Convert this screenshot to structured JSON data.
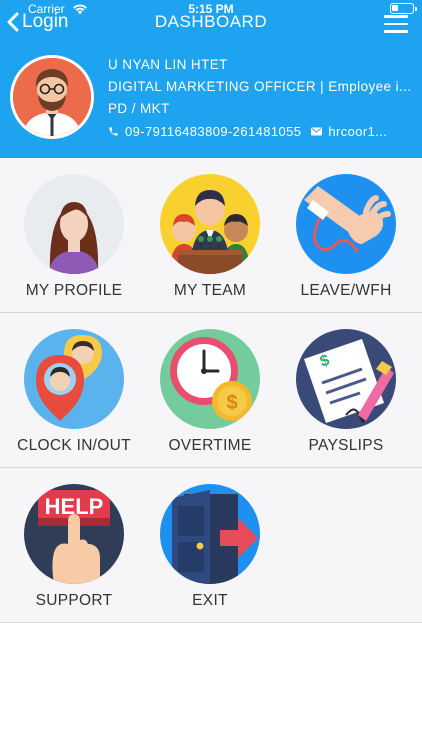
{
  "status_bar": {
    "carrier": "Carrier",
    "time": "5:15 PM"
  },
  "nav": {
    "back_label": "Login",
    "title": "DASHBOARD"
  },
  "profile": {
    "name": "U NYAN LIN HTET",
    "position": "DIGITAL MARKETING OFFICER | Employee i...",
    "department": "PD / MKT",
    "phone": "09-79116483809-261481055",
    "email": "hrcoor1..."
  },
  "tiles": [
    {
      "label": "MY PROFILE",
      "icon": "woman-profile-icon"
    },
    {
      "label": "MY TEAM",
      "icon": "team-icon"
    },
    {
      "label": "LEAVE/WFH",
      "icon": "bandaged-hand-icon"
    },
    {
      "label": "CLOCK IN/OUT",
      "icon": "location-pin-icon"
    },
    {
      "label": "OVERTIME",
      "icon": "clock-coin-icon"
    },
    {
      "label": "PAYSLIPS",
      "icon": "payslip-pen-icon"
    },
    {
      "label": "SUPPORT",
      "icon": "help-button-icon"
    },
    {
      "label": "EXIT",
      "icon": "door-exit-icon"
    }
  ],
  "support_help_text": "HELP",
  "colors": {
    "header": "#1ea3f0",
    "accent": "#ffffff"
  }
}
